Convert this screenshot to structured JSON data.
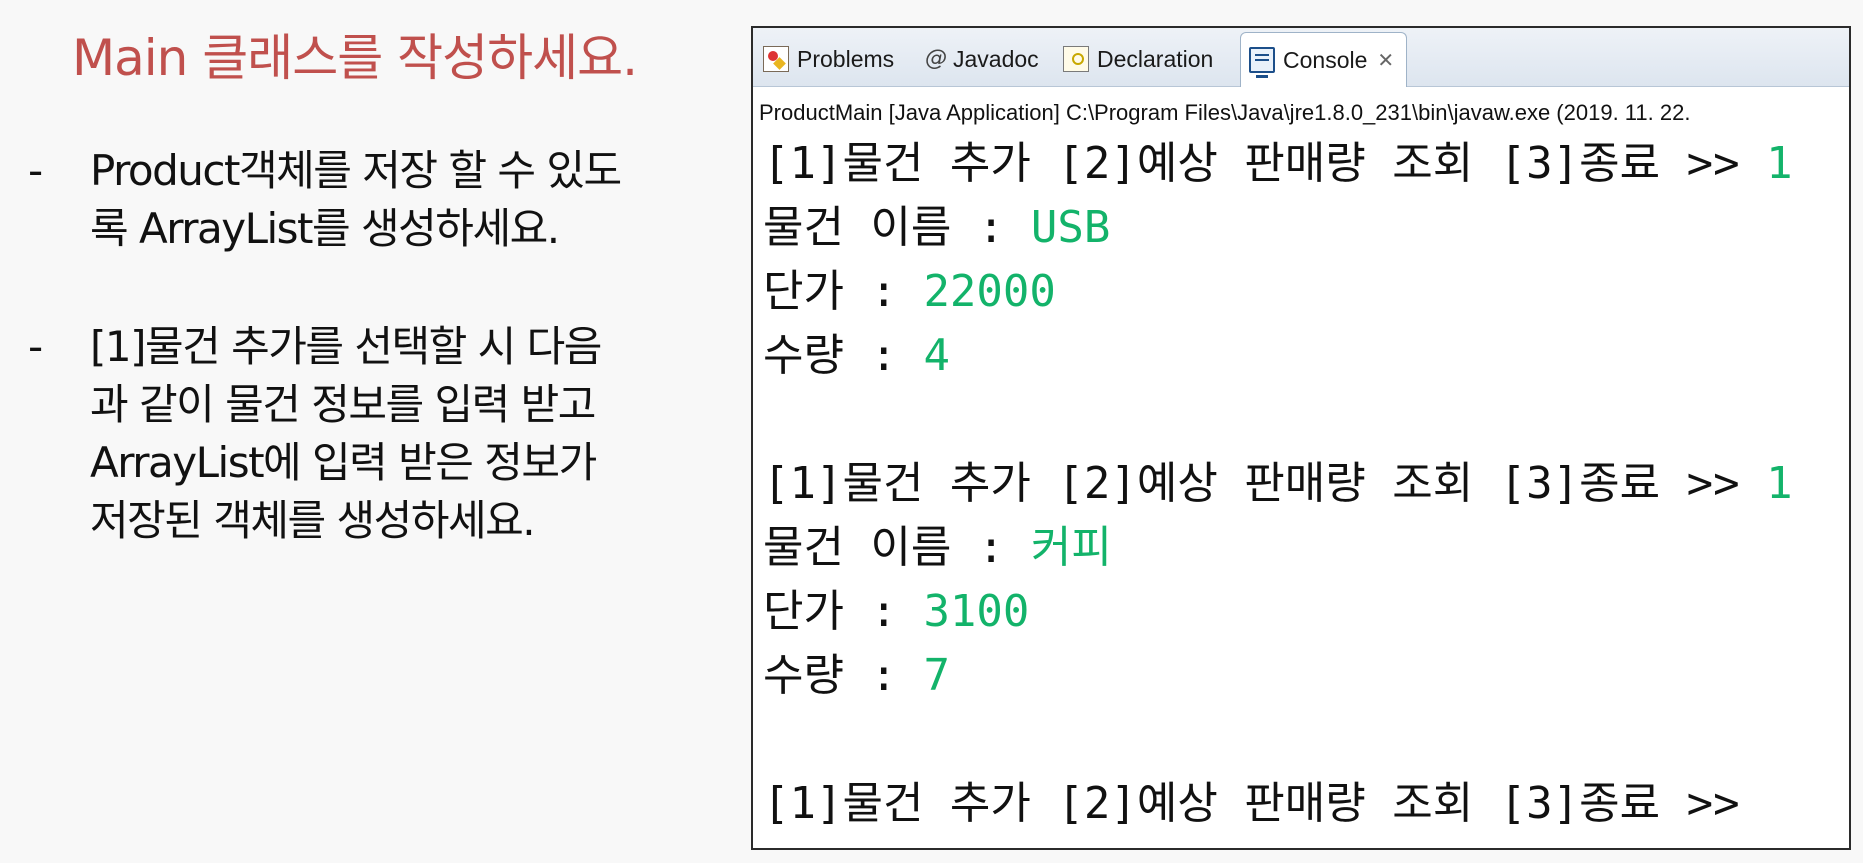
{
  "slide": {
    "title": "Main 클래스를 작성하세요.",
    "bullet_marker": "-",
    "bullets": [
      {
        "lines": [
          "Product객체를 저장 할 수 있도",
          "록 ArrayList를 생성하세요."
        ]
      },
      {
        "lines": [
          "[1]물건 추가를 선택할 시 다음",
          "과 같이 물건 정보를 입력 받고",
          "ArrayList에 입력 받은 정보가",
          "저장된 객체를 생성하세요."
        ]
      }
    ]
  },
  "eclipse": {
    "tabs": [
      {
        "label": "Problems",
        "icon": "problems-icon"
      },
      {
        "label": "Javadoc",
        "icon": "javadoc-icon",
        "icon_glyph": "@"
      },
      {
        "label": "Declaration",
        "icon": "declaration-icon"
      },
      {
        "label": "Console",
        "icon": "console-icon",
        "active": true,
        "close_glyph": "✕"
      }
    ],
    "launch_info": "ProductMain [Java Application] C:\\Program Files\\Java\\jre1.8.0_231\\bin\\javaw.exe (2019. 11. 22.",
    "console": {
      "input_color": "#13b36a",
      "lines": [
        {
          "prompt": "[1]물건 추가 [2]예상 판매량 조회 [3]종료 >> ",
          "input": "1"
        },
        {
          "prompt": "물건 이름 : ",
          "input": "USB"
        },
        {
          "prompt": "단가 : ",
          "input": "22000"
        },
        {
          "prompt": "수량 : ",
          "input": "4"
        },
        {
          "prompt": "",
          "input": ""
        },
        {
          "prompt": "[1]물건 추가 [2]예상 판매량 조회 [3]종료 >> ",
          "input": "1"
        },
        {
          "prompt": "물건 이름 : ",
          "input": "커피"
        },
        {
          "prompt": "단가 : ",
          "input": "3100"
        },
        {
          "prompt": "수량 : ",
          "input": "7"
        },
        {
          "prompt": "",
          "input": ""
        },
        {
          "prompt": "[1]물건 추가 [2]예상 판매량 조회 [3]종료 >>",
          "input": ""
        }
      ]
    }
  }
}
